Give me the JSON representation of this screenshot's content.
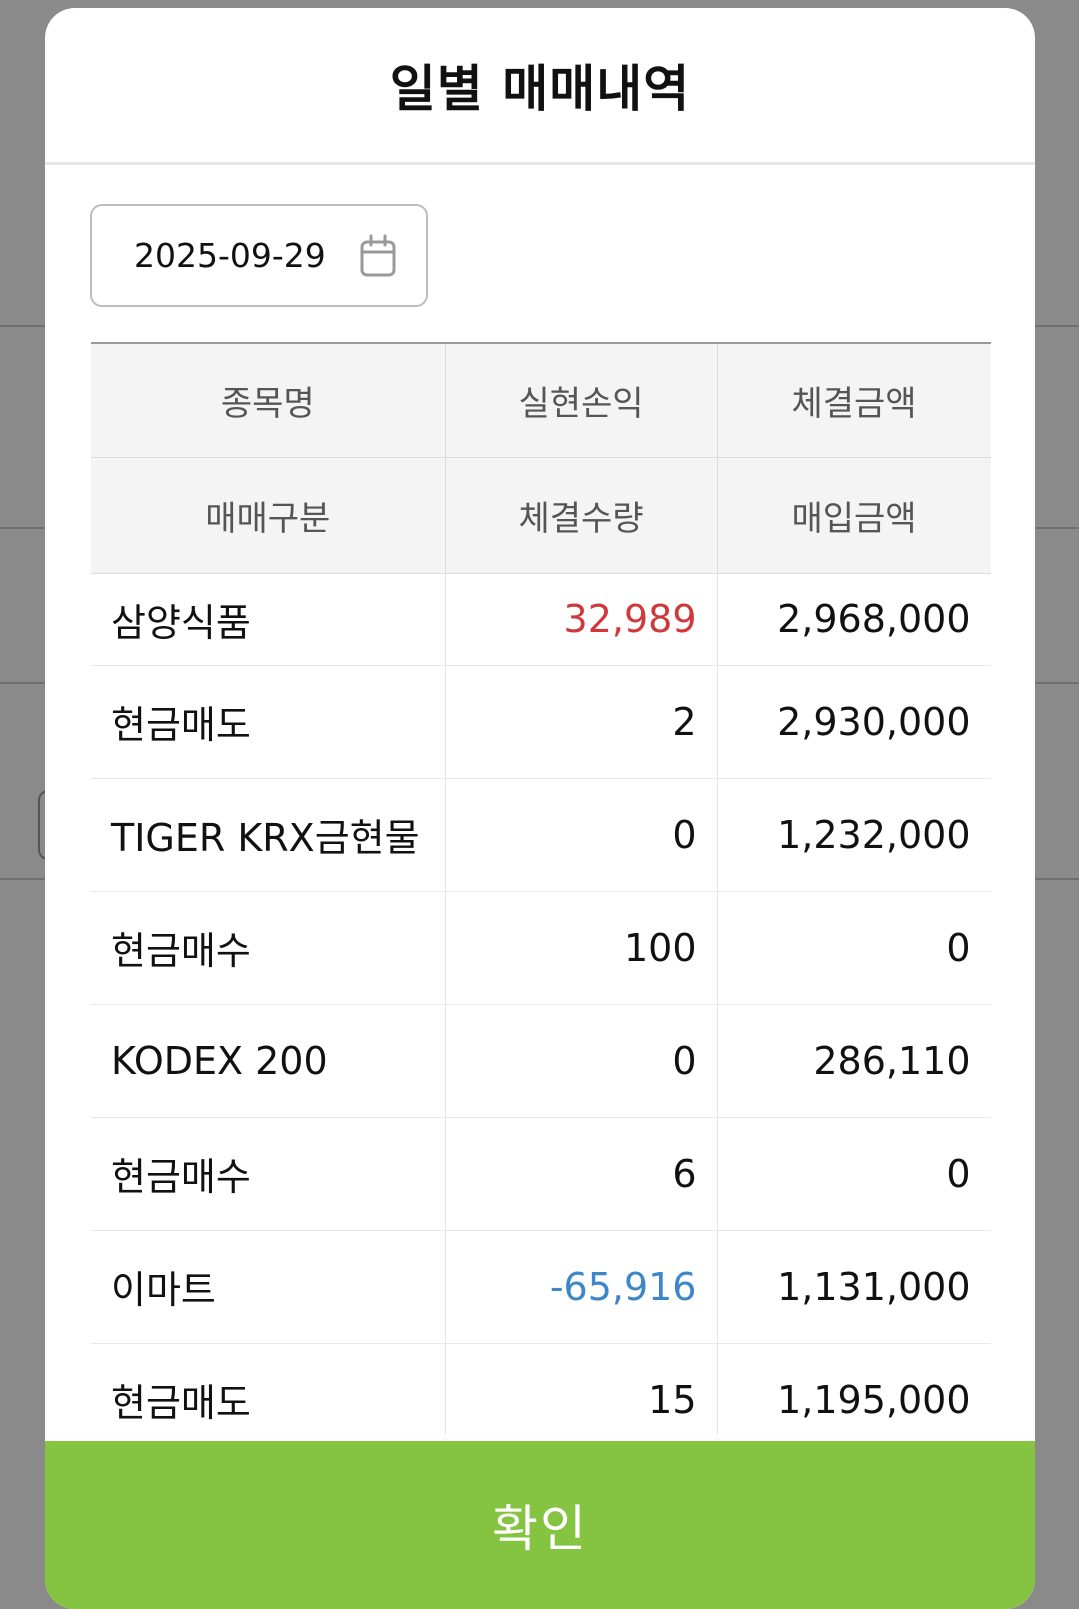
{
  "modal": {
    "title": "일별 매매내역",
    "date_value": "2025-09-29",
    "confirm_label": "확인"
  },
  "table": {
    "header_row1": [
      "종목명",
      "실현손익",
      "체결금액"
    ],
    "header_row2": [
      "매매구분",
      "체결수량",
      "매입금액"
    ],
    "rows": [
      [
        "삼양식품",
        "32,989",
        "2,968,000"
      ],
      [
        "현금매도",
        "2",
        "2,930,000"
      ],
      [
        "TIGER KRX금현물",
        "0",
        "1,232,000"
      ],
      [
        "현금매수",
        "100",
        "0"
      ],
      [
        "KODEX 200",
        "0",
        "286,110"
      ],
      [
        "현금매수",
        "6",
        "0"
      ],
      [
        "이마트",
        "-65,916",
        "1,131,000"
      ],
      [
        "현금매도",
        "15",
        "1,195,000"
      ]
    ]
  },
  "colors": {
    "profit": "#d0393b",
    "loss": "#3d87c9",
    "confirm_bg": "#85c440"
  },
  "icons": {
    "date_picker": "calendar-icon"
  }
}
